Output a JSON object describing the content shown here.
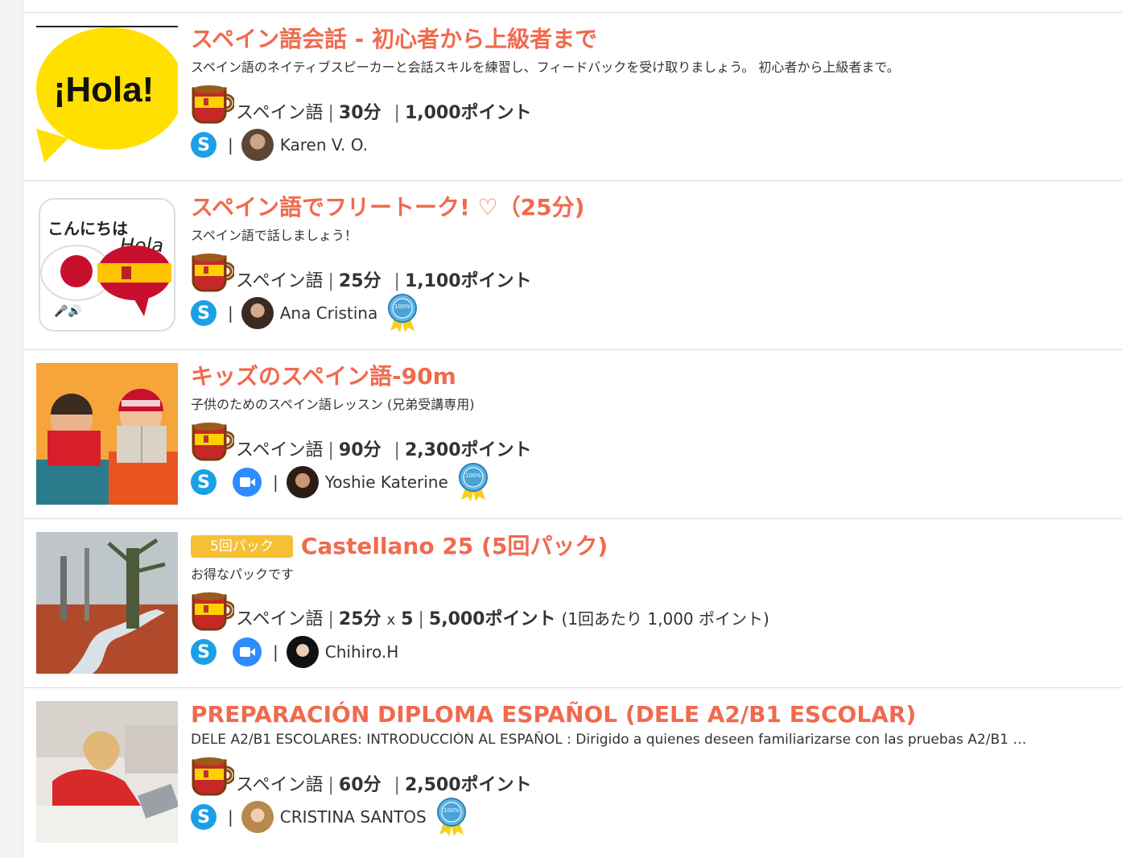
{
  "lessons": [
    {
      "title": "スペイン語会話 - 初心者から上級者まで",
      "description": "スペイン語のネイティブスピーカーと会話スキルを練習し、フィードバックを受け取りましょう。 初心者から上級者まで。",
      "language": "スペイン語",
      "duration": "30分",
      "points": "1,000ポイント",
      "teacher": "Karen V. O.",
      "thumb_text": "¡Hola!"
    },
    {
      "title": "スペイン語でフリートーク! ♡（25分)",
      "description": "スペイン語で話しましょう！",
      "language": "スペイン語",
      "duration": "25分",
      "points": "1,100ポイント",
      "teacher": "Ana Cristina",
      "thumb_text_jp": "こんにちは",
      "thumb_text_es": "Hola"
    },
    {
      "title": "キッズのスペイン語-90m",
      "description": "子供のためのスペイン語レッスン (兄弟受講専用)",
      "language": "スペイン語",
      "duration": "90分",
      "points": "2,300ポイント",
      "teacher": "Yoshie Katerine"
    },
    {
      "pack_label": "5回パック",
      "title": "Castellano 25 (5回パック)",
      "description": "お得なパックです",
      "language": "スペイン語",
      "duration": "25分",
      "multiplier": "x",
      "count": "5",
      "points": "5,000ポイント",
      "per_lesson": "(1回あたり 1,000 ポイント)",
      "teacher": "Chihiro.H"
    },
    {
      "title": "PREPARACIÓN DIPLOMA ESPAÑOL (DELE A2/B1 ESCOLAR)",
      "description": "DELE A2/B1 ESCOLARES: INTRODUCCIÓN AL ESPAÑOL : Dirigido a quienes deseen familiarizarse con las pruebas A2/B1 …",
      "language": "スペイン語",
      "duration": "60分",
      "points": "2,500ポイント",
      "teacher": "CRISTINA SANTOS"
    }
  ],
  "badge_text": "100%",
  "skype_glyph": "S",
  "separator": "|",
  "colors": {
    "title": "#f06a4e",
    "pack": "#f5c033",
    "skype": "#1aa0e6",
    "zoom": "#2d8cff"
  }
}
